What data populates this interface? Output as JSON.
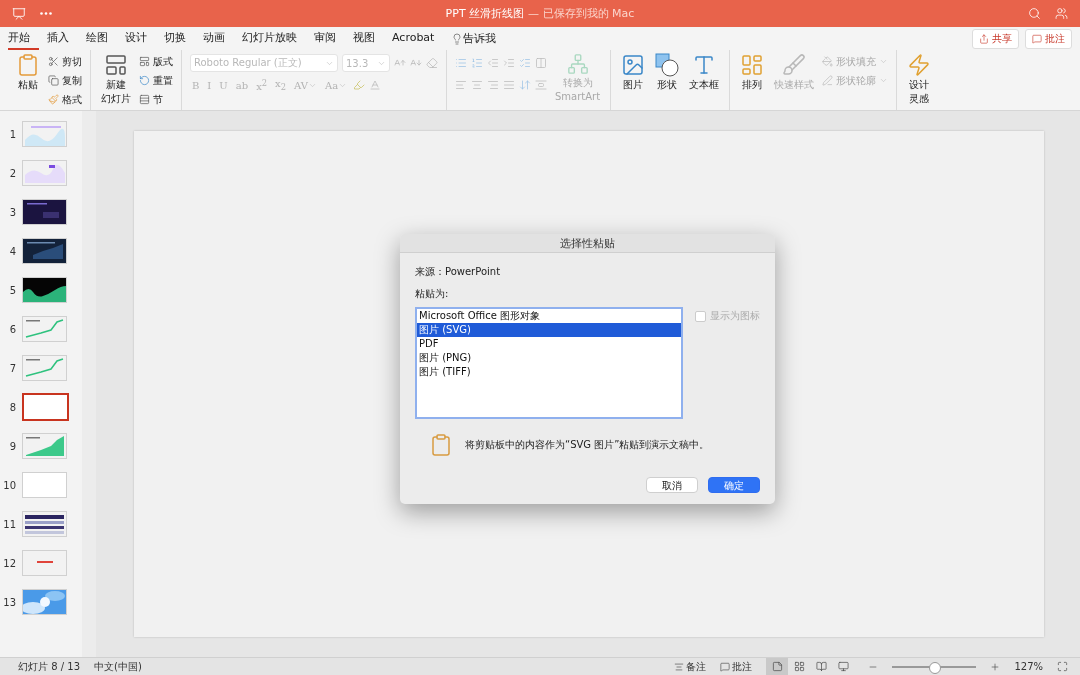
{
  "title_bar": {
    "title": "PPT 丝滑折线图",
    "save_status": "— 已保存到我的 Mac"
  },
  "ribbon_tabs": [
    {
      "label": "开始",
      "selected": true
    },
    {
      "label": "插入",
      "selected": false
    },
    {
      "label": "绘图",
      "selected": false
    },
    {
      "label": "设计",
      "selected": false
    },
    {
      "label": "切换",
      "selected": false
    },
    {
      "label": "动画",
      "selected": false
    },
    {
      "label": "幻灯片放映",
      "selected": false
    },
    {
      "label": "审阅",
      "selected": false
    },
    {
      "label": "视图",
      "selected": false
    },
    {
      "label": "Acrobat",
      "selected": false
    }
  ],
  "tell_me": "告诉我",
  "share_button": "共享",
  "comments_button": "批注",
  "clipboard": {
    "paste": "粘贴",
    "cut": "剪切",
    "copy": "复制",
    "format": "格式"
  },
  "slides_group": {
    "new_slide": [
      "新建",
      "幻灯片"
    ],
    "layout": "版式",
    "reset": "重置",
    "section": "节"
  },
  "font": {
    "font_name": "Roboto Regular (正文)",
    "font_size": "13.3",
    "disabled": true,
    "buttons": [
      {
        "label": "B",
        "dropdown": false
      },
      {
        "label": "I",
        "dropdown": false
      },
      {
        "label": "U",
        "dropdown": false
      },
      {
        "label": "ab",
        "dropdown": false
      },
      {
        "label": "x$^{2}$",
        "dropdown": false
      },
      {
        "label": "x$_{2}$",
        "dropdown": false
      },
      {
        "label": "AV",
        "dropdown": true
      },
      {
        "label": "Aa",
        "dropdown": true
      }
    ]
  },
  "smartart": {
    "label": [
      "转换为",
      "SmartArt"
    ],
    "disabled": true
  },
  "insert_group": [
    {
      "kind": "picture",
      "label": "图片",
      "disabled": false
    },
    {
      "kind": "shape",
      "label": "形状",
      "disabled": false
    },
    {
      "kind": "textbox",
      "label": "文本框",
      "disabled": false
    }
  ],
  "arrange": {
    "label": "排列",
    "disabled": false
  },
  "quick_styles": {
    "label": "快速样式",
    "disabled": true
  },
  "shape_fill": {
    "label": "形状填充",
    "disabled": true
  },
  "shape_outline": {
    "label": "形状轮廓",
    "disabled": true
  },
  "designer": {
    "label": [
      "设计",
      "灵感"
    ]
  },
  "slides": [
    {
      "number": "1",
      "kind": "light-chart",
      "selected": false
    },
    {
      "number": "2",
      "kind": "light-wave",
      "selected": false
    },
    {
      "number": "3",
      "kind": "dark-purple",
      "selected": false
    },
    {
      "number": "4",
      "kind": "dark-navy",
      "selected": false
    },
    {
      "number": "5",
      "kind": "black-green",
      "selected": false
    },
    {
      "number": "6",
      "kind": "green-line",
      "selected": false
    },
    {
      "number": "7",
      "kind": "green-line",
      "selected": false
    },
    {
      "number": "8",
      "kind": "blank",
      "selected": true
    },
    {
      "number": "9",
      "kind": "green-area",
      "selected": false
    },
    {
      "number": "10",
      "kind": "blank",
      "selected": false
    },
    {
      "number": "11",
      "kind": "grid",
      "selected": false
    },
    {
      "number": "12",
      "kind": "red-text",
      "selected": false
    },
    {
      "number": "13",
      "kind": "sky",
      "selected": false
    }
  ],
  "dialog": {
    "title": "选择性粘贴",
    "source": "来源：PowerPoint",
    "paste_as_label": "粘贴为:",
    "options": [
      {
        "label": "Microsoft Office 图形对象",
        "selected": false
      },
      {
        "label": "图片 (SVG)",
        "selected": true
      },
      {
        "label": "PDF",
        "selected": false
      },
      {
        "label": "图片 (PNG)",
        "selected": false
      },
      {
        "label": "图片 (TIFF)",
        "selected": false
      }
    ],
    "display_as_icon": {
      "label": "显示为图标",
      "checked": false,
      "disabled": true
    },
    "description": "将剪贴板中的内容作为“SVG 图片”粘贴到演示文稿中。",
    "buttons": [
      {
        "label": "取消",
        "primary": false
      },
      {
        "label": "确定",
        "primary": true
      }
    ]
  },
  "status_bar": {
    "slide_position": "幻灯片 8 / 13",
    "language": "中文(中国)",
    "notes": "备注",
    "comments": "批注",
    "views": [
      {
        "kind": "normal",
        "selected": true
      },
      {
        "kind": "sorter",
        "selected": false
      },
      {
        "kind": "reading",
        "selected": false
      },
      {
        "kind": "slideshow",
        "selected": false
      }
    ],
    "zoom": {
      "level": 0.5
    },
    "zoom_percent": "127%"
  }
}
